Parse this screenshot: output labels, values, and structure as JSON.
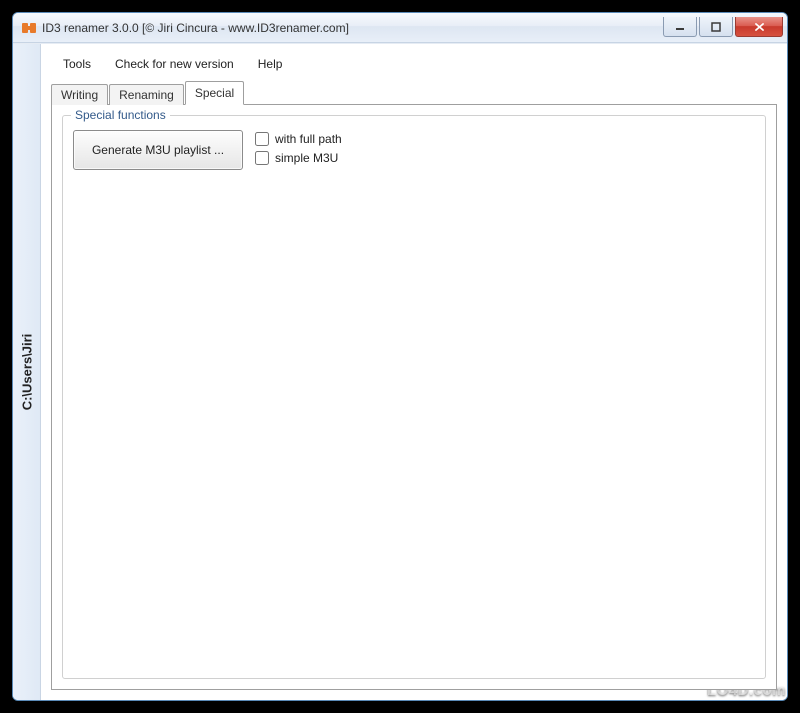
{
  "window": {
    "title": "ID3 renamer 3.0.0 [© Jiri Cincura - www.ID3renamer.com]"
  },
  "menubar": {
    "tools": "Tools",
    "check": "Check for new version",
    "help": "Help"
  },
  "tabs": {
    "writing": "Writing",
    "renaming": "Renaming",
    "special": "Special"
  },
  "panel": {
    "legend": "Special functions",
    "generate_button": "Generate M3U playlist ...",
    "check_full_path": "with full path",
    "check_simple_m3u": "simple M3U"
  },
  "sidebar": {
    "path": "C:\\Users\\Jiri"
  },
  "watermark": {
    "text": "LO4D.com"
  }
}
